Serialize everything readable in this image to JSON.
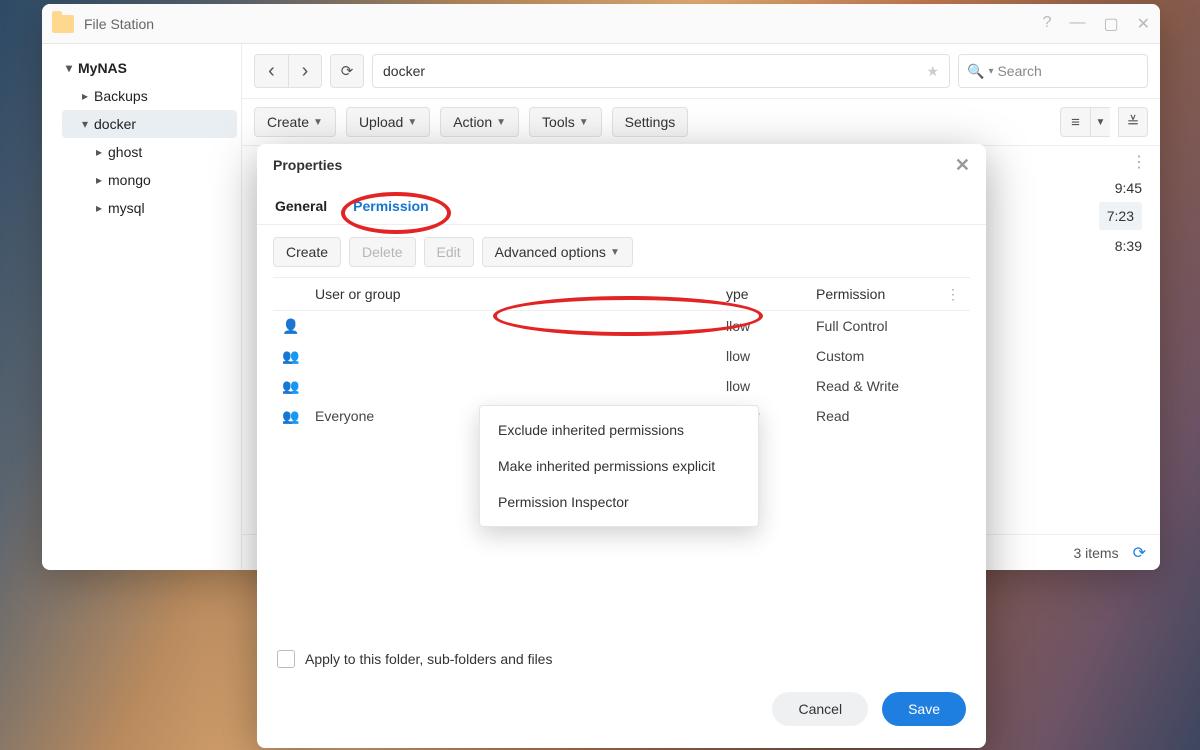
{
  "window": {
    "title": "File Station",
    "path": "docker",
    "search_placeholder": "Search",
    "item_count_label": "3 items",
    "toolbar": {
      "create": "Create",
      "upload": "Upload",
      "action": "Action",
      "tools": "Tools",
      "settings": "Settings"
    },
    "tree": {
      "root": "MyNAS",
      "items": [
        {
          "label": "Backups"
        },
        {
          "label": "docker",
          "selected": true,
          "children": [
            {
              "label": "ghost"
            },
            {
              "label": "mongo"
            },
            {
              "label": "mysql"
            }
          ]
        }
      ]
    },
    "visible_times": [
      "9:45",
      "7:23",
      "8:39"
    ]
  },
  "dialog": {
    "title": "Properties",
    "tabs": {
      "general": "General",
      "permission": "Permission"
    },
    "buttons": {
      "create": "Create",
      "delete": "Delete",
      "edit": "Edit",
      "advanced": "Advanced options"
    },
    "advanced_menu": [
      "Exclude inherited permissions",
      "Make inherited permissions explicit",
      "Permission Inspector"
    ],
    "columns": {
      "user": "User or group",
      "type": "ype",
      "perm": "Permission"
    },
    "rows": [
      {
        "user": "",
        "type": "llow",
        "perm": "Full Control"
      },
      {
        "user": "",
        "type": "llow",
        "perm": "Custom"
      },
      {
        "user": "",
        "type": "llow",
        "perm": "Read & Write"
      },
      {
        "user": "Everyone",
        "type": "Allow",
        "perm": "Read"
      }
    ],
    "apply_label": "Apply to this folder, sub-folders and files",
    "cancel": "Cancel",
    "save": "Save"
  }
}
